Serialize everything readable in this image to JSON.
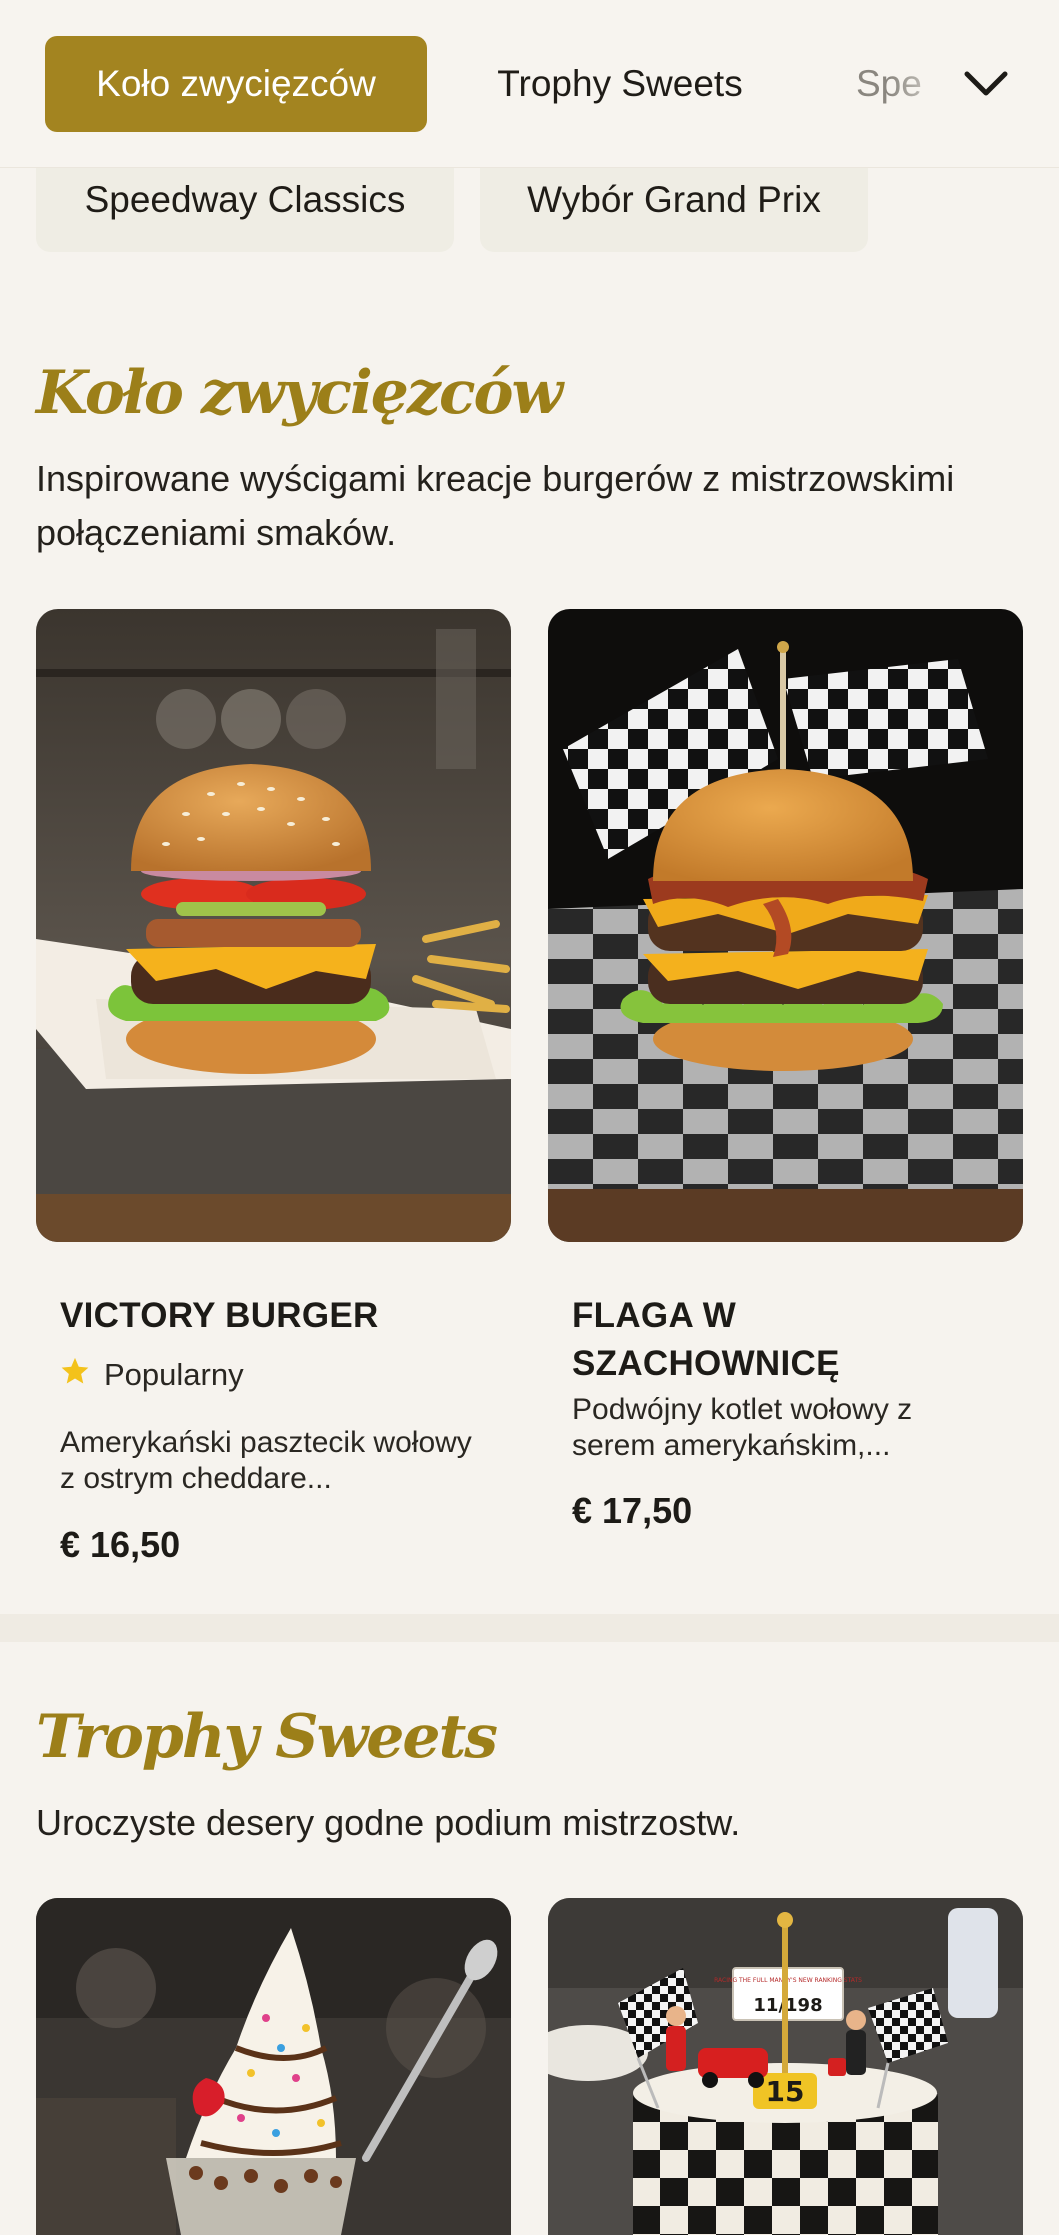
{
  "nav": {
    "tabs": [
      {
        "label": "Koło zwycięzców",
        "active": true
      },
      {
        "label": "Trophy Sweets",
        "active": false
      },
      {
        "label": "Spe",
        "active": false
      }
    ],
    "more_icon": "chevron-down-icon"
  },
  "chips": [
    "Speedway Classics",
    "Wybór Grand Prix"
  ],
  "sections": [
    {
      "title": "Koło zwycięzców",
      "description": "Inspirowane wyścigami kreacje burgerów z mistrzowskimi połączeniami smaków.",
      "items": [
        {
          "name": "VICTORY BURGER",
          "badge": "Popularny",
          "badge_icon": "star-icon",
          "description": "Amerykański pasztecik wołowy z ostrym cheddare...",
          "price": "€ 16,50"
        },
        {
          "name": "FLAGA W SZACHOWNICĘ",
          "description": "Podwójny kotlet wołowy z serem amerykańskim,...",
          "price": "€ 17,50"
        }
      ]
    },
    {
      "title": "Trophy Sweets",
      "description": "Uroczyste desery godne podium mistrzostw.",
      "items": [
        {
          "name": "",
          "description": "",
          "price": ""
        },
        {
          "name": "",
          "description": "",
          "price": "",
          "cake_text": "11/198",
          "cake_number": "15",
          "cake_banner": "RACING THE FULL MANDY'S NEW RANKING STATS"
        }
      ]
    }
  ],
  "colors": {
    "accent": "#a38420",
    "title": "#9c7f19",
    "star": "#f3c21b",
    "background": "#f6f3ee"
  }
}
